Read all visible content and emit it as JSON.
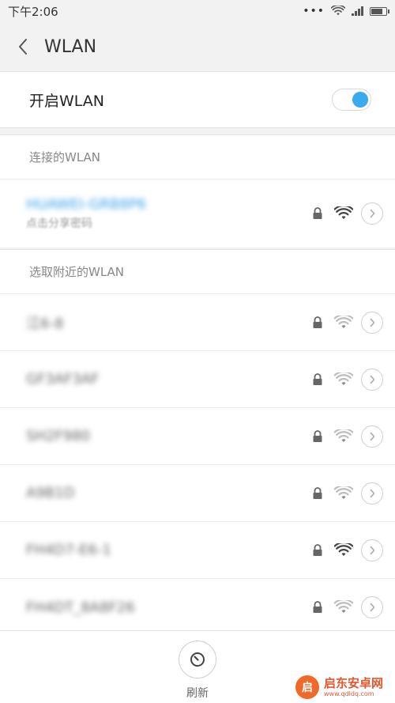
{
  "status_bar": {
    "time": "下午2:06",
    "dots": "•••"
  },
  "header": {
    "title": "WLAN"
  },
  "wlan_toggle": {
    "label": "开启WLAN",
    "enabled": true,
    "accent_color": "#3aaaf0"
  },
  "connected_section": {
    "title": "连接的WLAN",
    "network": {
      "name": "HUAWEI-GRB8P6",
      "subtitle": "点击分享密码",
      "locked": true,
      "signal": "strong"
    }
  },
  "nearby_section": {
    "title": "选取附近的WLAN",
    "networks": [
      {
        "name": "江6-8",
        "locked": true,
        "signal": "weak"
      },
      {
        "name": "GF3AF3AF",
        "locked": true,
        "signal": "weak"
      },
      {
        "name": "SH2F980",
        "locked": true,
        "signal": "weak"
      },
      {
        "name": "A9B1D",
        "locked": true,
        "signal": "weak"
      },
      {
        "name": "FH4D7-E6-1",
        "locked": true,
        "signal": "strong"
      },
      {
        "name": "FH4DT_8A8F26",
        "locked": true,
        "signal": "weak"
      }
    ]
  },
  "bottom_bar": {
    "refresh_label": "刷新"
  },
  "watermark": {
    "logo_text": "启",
    "name": "启东安卓网",
    "url": "www.qdldq.com"
  }
}
